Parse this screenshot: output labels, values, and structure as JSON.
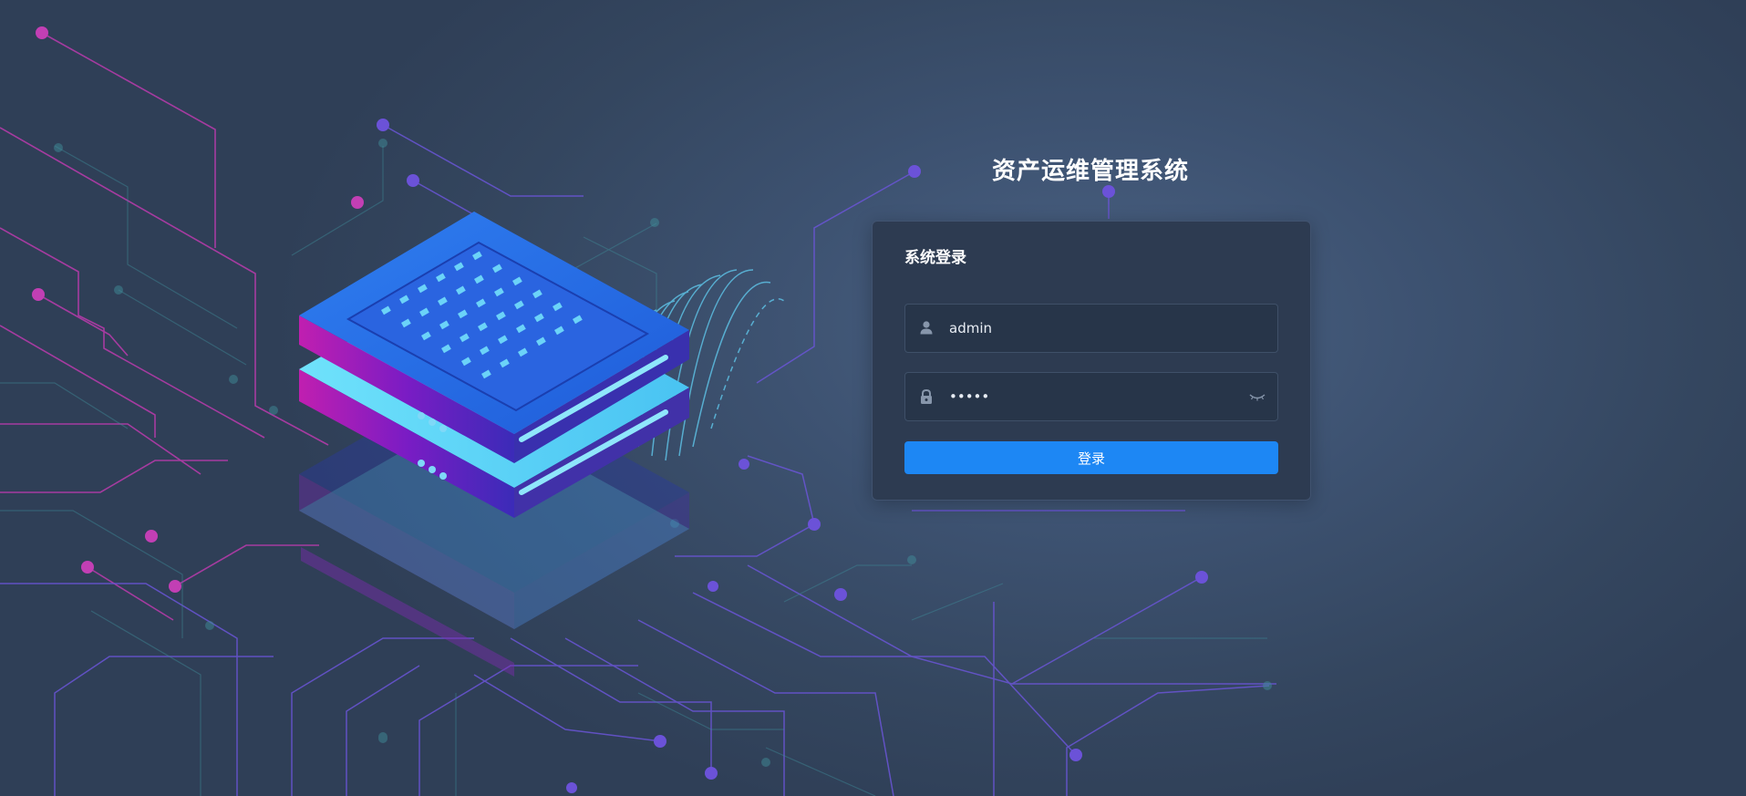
{
  "app": {
    "title": "资产运维管理系统"
  },
  "login_card": {
    "heading": "系统登录",
    "username": {
      "value": "admin",
      "icon": "user-icon"
    },
    "password": {
      "value": "•••••",
      "icon": "lock-icon",
      "toggle_icon": "eye-closed-icon"
    },
    "submit_label": "登录"
  },
  "colors": {
    "background": "#3d5271",
    "card": "#2d3b51",
    "input": "#273549",
    "accent": "#1d87f4",
    "circuit_pink": "#c23fb4",
    "circuit_violet": "#6b52d8"
  },
  "illustration": {
    "icon": "server-stack-icon"
  }
}
